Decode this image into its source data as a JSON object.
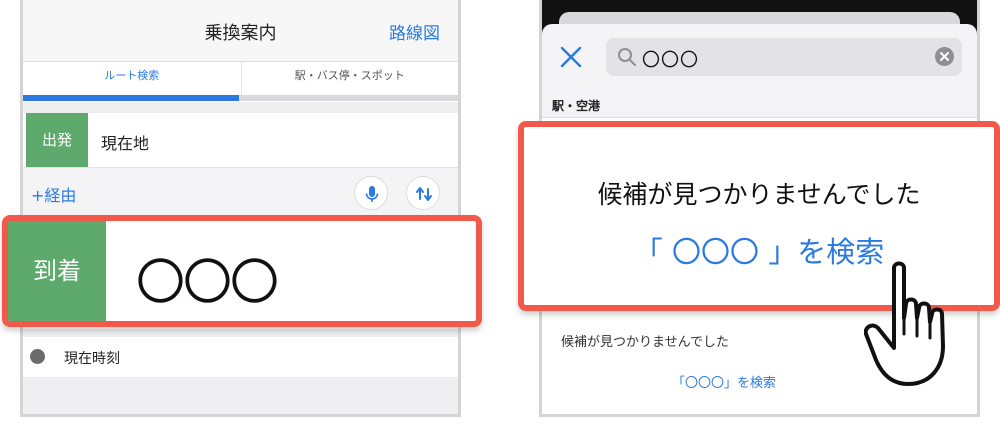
{
  "left": {
    "nav": {
      "title": "乗換案内",
      "route_map_link": "路線図"
    },
    "tabs": [
      {
        "label": "ルート検索",
        "active": true
      },
      {
        "label": "駅・バス停・スポット",
        "active": false
      }
    ],
    "departure": {
      "tag": "出発",
      "value": "現在地"
    },
    "via_link": "+経由",
    "icons": {
      "voice": "microphone-icon",
      "swap": "swap-arrows-icon"
    },
    "arrival": {
      "tag": "到着",
      "value": "〇〇〇"
    },
    "time_option": {
      "icon": "clock-icon",
      "label": "現在時刻"
    }
  },
  "right": {
    "search": {
      "value": "〇〇〇",
      "close_icon": "close-icon",
      "search_icon": "search-icon",
      "clear_icon": "clear-icon"
    },
    "section_label": "駅・空港",
    "no_results_message": "候補が見つかりませんでした",
    "search_for_link": "「〇〇〇」を検索",
    "callout": {
      "message": "候補が見つかりませんでした",
      "link": "「 〇〇〇 」を検索"
    }
  },
  "colors": {
    "accent_blue": "#2a7ae2",
    "tag_green": "#5daa6c",
    "highlight_red": "#f15a4a"
  }
}
